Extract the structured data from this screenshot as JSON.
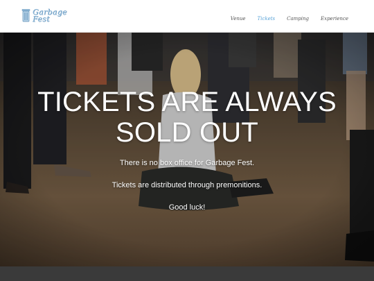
{
  "brand": {
    "line1": "Garbage",
    "line2": "Fest"
  },
  "nav": {
    "items": [
      {
        "label": "Venue",
        "active": false
      },
      {
        "label": "Tickets",
        "active": true
      },
      {
        "label": "Camping",
        "active": false
      },
      {
        "label": "Experience",
        "active": false
      }
    ]
  },
  "hero": {
    "title_line1": "TICKETS ARE ALWAYS",
    "title_line2": "SOLD OUT",
    "line1": "There is no box office for Garbage Fest.",
    "line2": "Tickets are distributed through premonitions.",
    "line3": "Good luck!"
  },
  "colors": {
    "nav_active": "#5aa4d8",
    "nav_text": "#555555",
    "footer_strip": "#3a3a3a"
  }
}
